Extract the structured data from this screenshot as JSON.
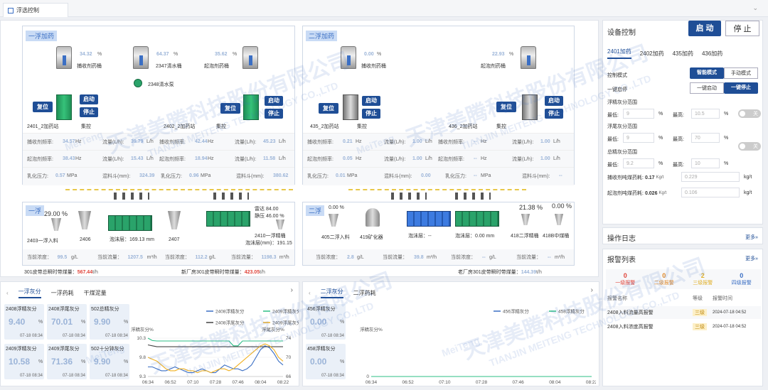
{
  "tab": {
    "title": "浮选控制"
  },
  "left_panel": {
    "title": "一浮加药",
    "tanks": [
      {
        "value": "34.32",
        "unit": "%",
        "label": "捕收剂药桶"
      },
      {
        "value": "64.37",
        "unit": "%",
        "label": "2347清水桶"
      },
      {
        "value": "35.62",
        "unit": "%",
        "label": "起泡剂药桶"
      }
    ],
    "pump": "2348清水泵",
    "stations": [
      {
        "name": "2401_2加药站",
        "control": "集控",
        "btn_reset": "复位",
        "btn_start": "启动",
        "btn_stop": "停止"
      },
      {
        "name": "2402_2加药站",
        "control": "集控",
        "btn_reset": "复位",
        "btn_start": "启动",
        "btn_stop": "停止"
      }
    ],
    "stats": [
      [
        "捕收剂频率:",
        "34.57",
        "Hz",
        "流量(L/h):",
        "39.79",
        "L/h",
        "捕收剂频率:",
        "42.44",
        "Hz",
        "流量(L/h):",
        "45.23",
        "L/h"
      ],
      [
        "起泡剂频率:",
        "38.43",
        "Hz",
        "流量(L/h):",
        "15.43",
        "L/h",
        "起泡剂频率:",
        "18.94",
        "Hz",
        "流量(L/h):",
        "11.58",
        "L/h"
      ],
      [
        "乳化压力:",
        "0.57",
        "MPa",
        "混料斗(mm):",
        "324.39",
        "",
        "乳化压力:",
        "0.96",
        "MPa",
        "混料斗(mm):",
        "380.62",
        ""
      ]
    ]
  },
  "right_panel": {
    "title": "二浮加药",
    "tanks": [
      {
        "value": "0.00",
        "unit": "%",
        "label": "捕收剂药桶"
      },
      {
        "value": "22.93",
        "unit": "%",
        "label": "起泡剂药桶"
      }
    ],
    "stations": [
      {
        "name": "435_2加药站",
        "control": "集控",
        "btn_reset": "复位",
        "btn_start": "启动",
        "btn_stop": "停止"
      },
      {
        "name": "436_2加药站",
        "control": "集控",
        "btn_reset": "复位",
        "btn_start": "启动",
        "btn_stop": "停止"
      }
    ],
    "stats": [
      [
        "捕收剂频率:",
        "0.21",
        "Hz",
        "流量(L/h):",
        "1.00",
        "L/h",
        "捕收剂频率:",
        "--",
        "Hz",
        "流量(L/h):",
        "1.00",
        "L/h"
      ],
      [
        "起泡剂频率:",
        "0.05",
        "Hz",
        "流量(L/h):",
        "1.00",
        "L/h",
        "起泡剂频率:",
        "--",
        "Hz",
        "流量(L/h):",
        "1.00",
        "L/h"
      ],
      [
        "乳化压力:",
        "0.01",
        "MPa",
        "混料斗(mm):",
        "0.00",
        "",
        "乳化压力:",
        "--",
        "MPa",
        "混料斗(mm):",
        "--",
        ""
      ]
    ]
  },
  "flot1": {
    "title": "一浮",
    "pct1": "29.00 %",
    "feed": "2403一浮入料",
    "m2406": "2406",
    "foam1": "泡沫层：169.13 mm",
    "m2407": "2407",
    "thunder": "雷达 84.00",
    "static": "静压 46.00 %",
    "tail": "2410一浮精桶",
    "foam2": "泡沫层(mm)：191.15",
    "bottom": [
      "当前浓度：",
      "99.5",
      "g/L",
      "当前流量：",
      "1207.5",
      "m³/h",
      "当前浓度：",
      "112.2",
      "g/L",
      "当前流量：",
      "1198.3",
      "m³/h"
    ]
  },
  "flot2": {
    "title": "二浮",
    "pct1": "0.00 %",
    "feed": "405二浮入料",
    "m419": "419矿化器",
    "foam1": "泡沫层：--",
    "foam2": "泡沫层：0.00 mm",
    "pct2": "21.38 %",
    "pct3": "0.00 %",
    "t418": "418二浮精桶",
    "t418b": "418B中煤桶",
    "bottom": [
      "当前浓度：",
      "2.8",
      "g/L",
      "当前流量：",
      "39.8",
      "m³/h",
      "当前浓度：",
      "--",
      "g/L",
      "当前流量：",
      "--",
      "m³/h"
    ]
  },
  "belt1": {
    "label": "301皮带总瞬时带煤量：",
    "value": "567.44",
    "unit": "t/h"
  },
  "belt2": {
    "label": "新厂房301皮带瞬时带煤量：",
    "value": "423.05",
    "unit": "t/h"
  },
  "belt3": {
    "label": "老厂房301皮带瞬时带煤量：",
    "value": "144.39",
    "unit": "t/h"
  },
  "device": {
    "title": "设备控制",
    "start": "启 动",
    "stop": "停 止",
    "tabs": [
      "2401加药",
      "2402加药",
      "435加药",
      "436加药"
    ],
    "mode_label": "控制模式",
    "mode_smart": "智能模式",
    "mode_manual": "手动模式",
    "onekey_label": "一键启停",
    "onekey_start": "一键启动",
    "onekey_stop": "一键停止",
    "ranges": [
      {
        "title": "浮精灰分范围",
        "low": "最低:",
        "lowv": "9",
        "high": "最高:",
        "highv": "10.5",
        "unit": "%",
        "toggle": "关"
      },
      {
        "title": "浮尾灰分范围",
        "low": "最低:",
        "lowv": "9",
        "high": "最高:",
        "highv": "70",
        "unit": "%",
        "toggle": "关"
      },
      {
        "title": "总精灰分范围",
        "low": "最低:",
        "lowv": "9.2",
        "high": "最高:",
        "highv": "10",
        "unit": "%"
      }
    ],
    "consume": [
      {
        "label": "捕收剂吨煤药耗:",
        "value": "0.17",
        "unit": "Kg/t",
        "input": "0.229",
        "u2": "kg/t"
      },
      {
        "label": "起泡剂吨煤药耗:",
        "value": "0.026",
        "unit": "Kg/t",
        "input": "0.106",
        "u2": "kg/t"
      }
    ]
  },
  "log": {
    "title": "操作日志",
    "more": "更多»"
  },
  "alarm": {
    "title": "报警列表",
    "more": "更多»",
    "levels": [
      {
        "count": "0",
        "label": "一级报警",
        "color": "#e0443a"
      },
      {
        "count": "0",
        "label": "二级报警",
        "color": "#e08a2a"
      },
      {
        "count": "2",
        "label": "三级报警",
        "color": "#e0b02a"
      },
      {
        "count": "0",
        "label": "四级报警",
        "color": "#3b6fc4"
      }
    ],
    "headers": [
      "报警名称",
      "等级",
      "报警时间"
    ],
    "rows": [
      {
        "name": "2408入料流量高报警",
        "level": "三级",
        "time": "2024-07-18 04:52"
      },
      {
        "name": "2408入料浓度高报警",
        "level": "三级",
        "time": "2024-07-18 04:52"
      }
    ]
  },
  "ash1": {
    "tabs": [
      "一浮灰分",
      "一浮药耗",
      "干煤泥量"
    ],
    "cards": [
      {
        "title": "2408浮精灰分",
        "value": "9.40",
        "unit": "%",
        "time": "07-18 08:34"
      },
      {
        "title": "2408浮尾灰分",
        "value": "70.01",
        "unit": "%",
        "time": "07-18 08:34"
      },
      {
        "title": "502总精灰分",
        "value": "9.90",
        "unit": "%",
        "time": "07-18 08:34"
      },
      {
        "title": "2409浮精灰分",
        "value": "10.58",
        "unit": "%",
        "time": "07-18 08:34"
      },
      {
        "title": "2409浮尾灰分",
        "value": "71.36",
        "unit": "%",
        "time": "07-18 08:34"
      },
      {
        "title": "502十分钟灰分",
        "value": "9.90",
        "unit": "%",
        "time": "07-18 08:34"
      }
    ]
  },
  "ash2": {
    "tabs": [
      "二浮灰分",
      "二浮药耗"
    ],
    "cards": [
      {
        "title": "456浮精灰分",
        "value": "0.00",
        "unit": "%",
        "time": "07-18 08:34"
      },
      {
        "title": "458浮精灰分",
        "value": "0.00",
        "unit": "%",
        "time": "07-18 08:34"
      }
    ]
  },
  "chart_data": [
    {
      "type": "line",
      "ylabel": "浮精灰分%",
      "ylabel2": "浮尾灰分%",
      "x": [
        "06:34",
        "06:52",
        "07:10",
        "07:28",
        "07:46",
        "08:04",
        "08:22"
      ],
      "ylim": [
        9.3,
        10.3
      ],
      "ylim2": [
        66,
        74
      ],
      "yticks": [
        "10.3",
        "9.8",
        "9.3"
      ],
      "yticks2": [
        "74",
        "70",
        "66"
      ],
      "series": [
        {
          "name": "2408浮精灰分",
          "color": "#3b6fc4",
          "axis": "left",
          "values": [
            9.55,
            9.55,
            9.5,
            9.45,
            9.45,
            9.5,
            9.55,
            9.5,
            9.45,
            9.4,
            9.4,
            9.45,
            9.5,
            9.45,
            9.4,
            9.4,
            9.5,
            9.6,
            9.55,
            9.5,
            9.5,
            9.45,
            9.5,
            9.6,
            9.8,
            10.0,
            10.1,
            10.05,
            9.9,
            9.7,
            9.6
          ]
        },
        {
          "name": "2409浮精灰分",
          "color": "#2dbf86",
          "axis": "right",
          "values": [
            74,
            73.5,
            73.4,
            73.4,
            73.4,
            73.4,
            73.4,
            73.4,
            73.4,
            73.4,
            73.4,
            73.4,
            73.4,
            73.4,
            73.4,
            73.4,
            73.4,
            73.4,
            73.4,
            72.4,
            72.4,
            73.4,
            73.4,
            73.4,
            73.4,
            73.4,
            73.4,
            73.4,
            73.4,
            73.4,
            73.4
          ]
        },
        {
          "name": "2408浮尾灰分",
          "color": "#444444",
          "axis": "right",
          "values": [
            72.6,
            72.4,
            72.2,
            72.2,
            72.2,
            72.2,
            72.2,
            72.2,
            72.2,
            72.2,
            72.2,
            72.2,
            72.2,
            72.2,
            72.2,
            72.2,
            72.2,
            72.2,
            72.2,
            72.2,
            72.2,
            72.2,
            72.2,
            72.2,
            72.2,
            72.2,
            72.2,
            72.2,
            72.2,
            72.2,
            72.2
          ]
        },
        {
          "name": "2409浮尾灰分",
          "color": "#f0b020",
          "axis": "left",
          "values": [
            9.8,
            9.75,
            9.7,
            9.6,
            9.5,
            9.45,
            9.45,
            9.5,
            9.5,
            9.45,
            9.45,
            9.4,
            9.45,
            9.45,
            9.4,
            9.45,
            9.5,
            9.5,
            9.45,
            9.5,
            9.6,
            9.7,
            9.8,
            9.9,
            10.0,
            10.1,
            10.15,
            10.1,
            10.0,
            9.8,
            9.7
          ]
        }
      ]
    },
    {
      "type": "line",
      "ylabel": "浮精灰分%",
      "x": [
        "06:34",
        "06:52",
        "07:10",
        "07:28",
        "07:46",
        "08:04",
        "08:22"
      ],
      "yticks": [
        "0"
      ],
      "series": [
        {
          "name": "456浮精灰分",
          "color": "#3b6fc4",
          "values": [
            0,
            0,
            0,
            0,
            0,
            0,
            0
          ]
        },
        {
          "name": "458浮精灰分",
          "color": "#2dbf86",
          "values": [
            0,
            0,
            0,
            0,
            0,
            0,
            0
          ]
        }
      ]
    }
  ],
  "watermark": "天津美腾科技股份有限公司",
  "watermark_en": "TIANJIN MEITENG TECHNOLOGY CO.,LTD",
  "watermark_logo": "MeiTeng"
}
